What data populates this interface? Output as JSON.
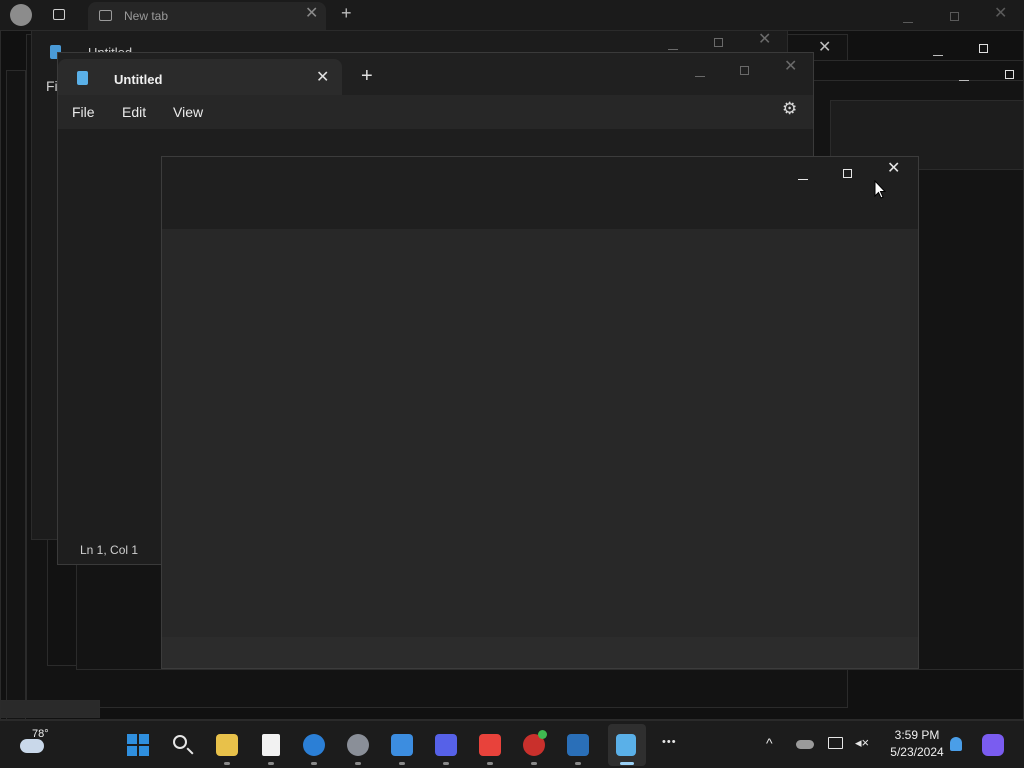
{
  "browser": {
    "tab_title": "New tab"
  },
  "background_window": {
    "title": "Untitled",
    "menu_partial": "Fil"
  },
  "notepad": {
    "tab_title": "Untitled",
    "new_tab": "+",
    "menu": [
      "File",
      "Edit",
      "View"
    ],
    "status": "Ln 1, Col 1"
  },
  "taskbar": {
    "weather_temp": "78°",
    "clock_time": "3:59 PM",
    "clock_date": "5/23/2024",
    "more_apps": "•••"
  },
  "colors": {
    "windows_blue": "#2f8fde",
    "notepad_blue": "#5ab0e8",
    "store_red": "#e8423b"
  }
}
